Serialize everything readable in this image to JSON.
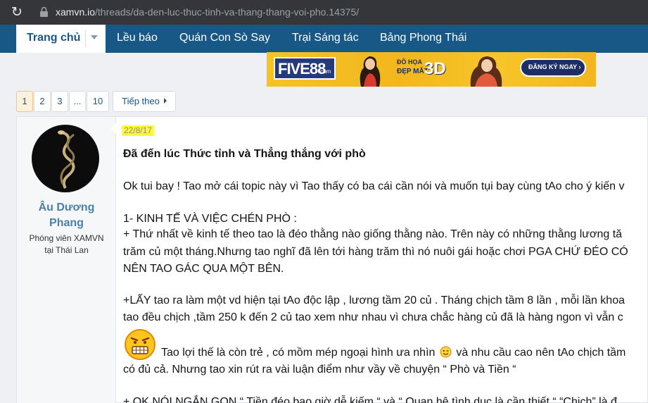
{
  "browser": {
    "url_host": "xamvn.io",
    "url_path": "/threads/da-den-luc-thuc-tinh-va-thang-thang-voi-pho.14375/",
    "reload_icon": "reload-icon",
    "lock_icon": "lock-icon"
  },
  "nav": {
    "home": "Trang chủ",
    "items": [
      "Lều báo",
      "Quán Con Sò Say",
      "Trại Sáng tác",
      "Bảng Phong Thái"
    ]
  },
  "banner": {
    "brand": "FIVE88",
    "brand_suffix": ".com",
    "line1": "ĐỒ HỌA",
    "line2": "ĐẸP MẮT",
    "big": "3D",
    "cta": "ĐĂNG KÝ NGAY ›"
  },
  "pagination": {
    "pages": [
      "1",
      "2",
      "3",
      "...",
      "10"
    ],
    "current": "1",
    "next": "Tiếp theo"
  },
  "post": {
    "author": {
      "name_line1": "Âu Dương",
      "name_line2": "Phang",
      "title_line1": "Phóng viên XAMVN",
      "title_line2": "tại Thái Lan"
    },
    "date": "22/8/17",
    "title": "Đã đến lúc Thức tỉnh và Thẳng thắng với phò",
    "lines": {
      "l1": "Ok tui bay ! Tao mở cái topic này vì Tao thấy có ba cái cần nói và muốn tụi bay cùng tAo cho ý kiến v",
      "l2": "1- KINH TẾ VÀ VIỆC CHÉN PHÒ :",
      "l3": "+ Thứ nhất về kinh tế theo tao là đéo thằng nào giống thằng nào. Trên này có những thằng lương tă",
      "l4": "trăm củ một tháng.Nhưng tao nghĩ đã lên tới hàng trăm thì nó nuôi gái hoặc chơi PGA CHỨ ĐÉO CÓ",
      "l5": "NÊN TAO GÁC QUA MỘT BÊN.",
      "l6": "+LẤY tao ra làm một vd hiện tại tAo độc lập , lương tầm 20 củ . Tháng chịch tầm 8 lần , mỗi lần khoa",
      "l7": "tao đều chịch ,tầm 250 k đến 2 củ tao xem như nhau vì chưa chắc hàng củ đã là hàng ngon vì vẫn c",
      "l8a": "Tao lợi thế là còn trẻ , có mồm mép ngoại hình ưa nhìn",
      "l8b": "và nhu cầu cao nên tAo chịch tầm",
      "l9": "có đủ cả. Nhưng tao xin rút ra vài luận điểm như vầy về chuyện “ Phò và Tiền “",
      "l10": "+ OK NÓI NGẮN GỌN “ Tiền đéo bao giờ dễ kiếm “ và “ Quan hệ tình dục là cần thiết “ “Chịch” là đ"
    }
  }
}
